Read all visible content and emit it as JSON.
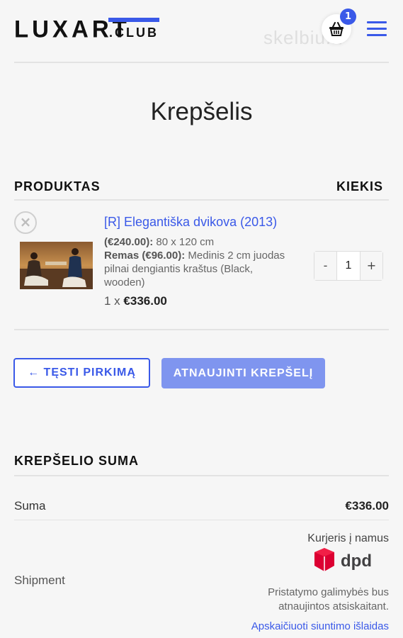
{
  "header": {
    "logo_main": "LUXART",
    "logo_suffix": ".CLUB",
    "watermark": "skelbiu.lt",
    "cart_count": "1",
    "cart_icon": "basket-icon",
    "menu_icon": "hamburger-menu-icon"
  },
  "page": {
    "title": "Krepšelis"
  },
  "cart_table": {
    "col_product": "PRODUKTAS",
    "col_quantity": "KIEKIS",
    "items": [
      {
        "remove_icon": "close-icon",
        "remove_glyph": "×",
        "name": "[R] Elegantiška dvikova (2013)",
        "size_price": "(€240.00):",
        "size_value": "80 x 120 cm",
        "frame_label": "Remas (€96.00):",
        "frame_value": "Medinis 2 cm juodas pilnai dengiantis kraštus (Black, wooden)",
        "qty_prefix": "1 x",
        "line_total": "€336.00",
        "qty_minus": "-",
        "qty_value": "1",
        "qty_plus": "+"
      }
    ]
  },
  "actions": {
    "continue_label": "← TĘSTI PIRKIMĄ",
    "update_label": "ATNAUJINTI KREPŠELĮ"
  },
  "totals": {
    "title": "KREPŠELIO SUMA",
    "subtotal_label": "Suma",
    "subtotal_value": "€336.00",
    "shipment_label": "Shipment",
    "courier_label": "Kurjeris į namus",
    "carrier_logo_text": "dpd",
    "shipping_note": "Pristatymo galimybės bus atnaujintos atsiskaitant.",
    "calc_link": "Apskaičiuoti siuntimo išlaidas"
  },
  "colors": {
    "accent": "#3a59e8",
    "accent_light": "#7f95ef",
    "dpd_red": "#dc0032",
    "background": "#f6f6f6"
  }
}
